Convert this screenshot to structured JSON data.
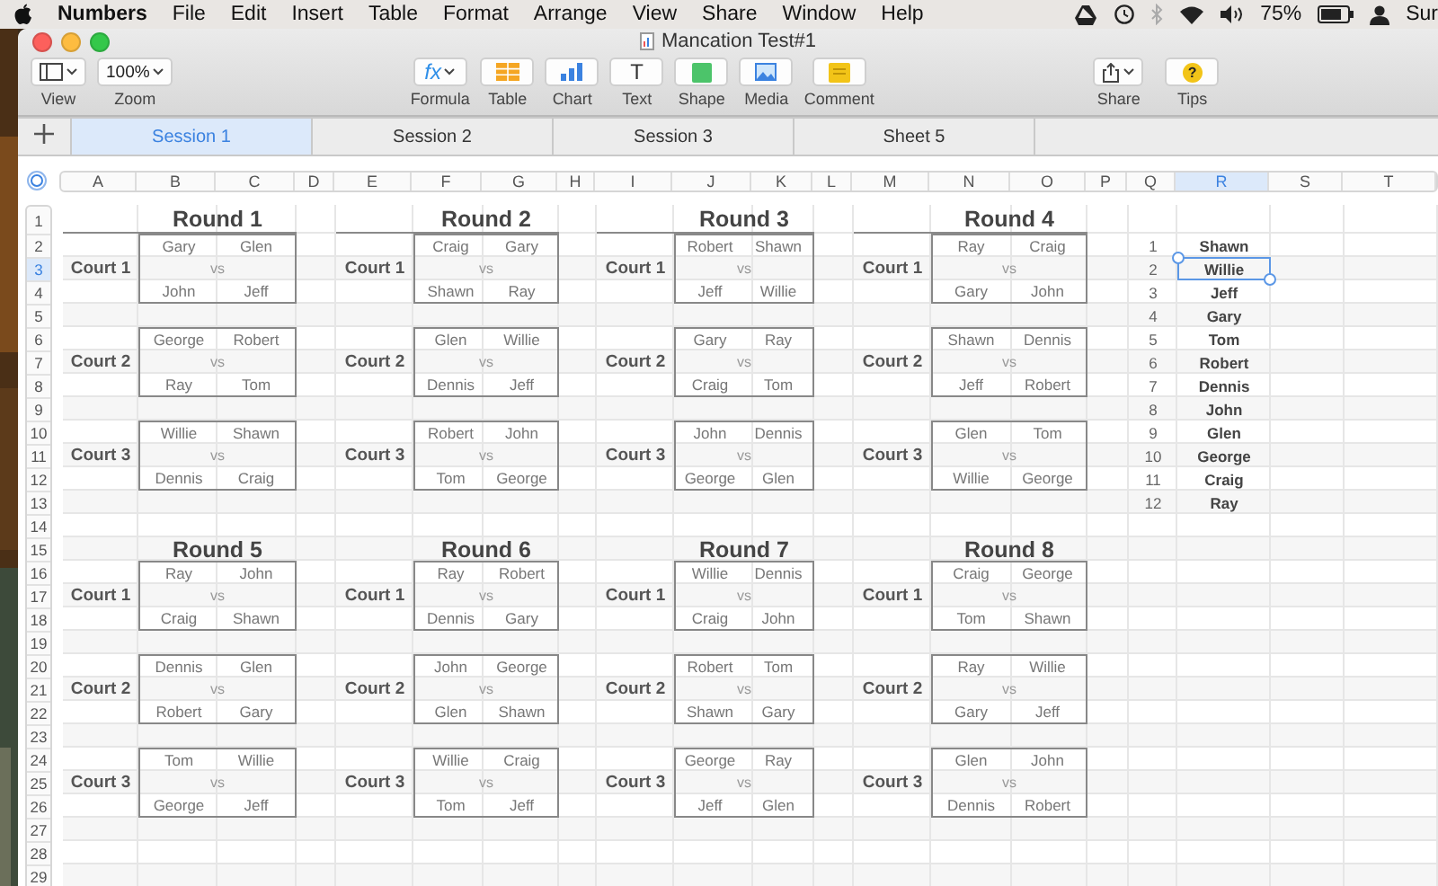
{
  "menu_bar": {
    "app": "Numbers",
    "items": [
      "File",
      "Edit",
      "Insert",
      "Table",
      "Format",
      "Arrange",
      "View",
      "Share",
      "Window",
      "Help"
    ],
    "battery": "75%",
    "user": "Sur"
  },
  "window": {
    "title": "Mancation Test#1"
  },
  "toolbar": {
    "left": [
      {
        "kind": "view",
        "label": "View"
      },
      {
        "kind": "zoom",
        "label": "Zoom",
        "value": "100%"
      }
    ],
    "center": [
      {
        "kind": "formula",
        "label": "Formula",
        "glyph": "fx"
      },
      {
        "kind": "table",
        "label": "Table"
      },
      {
        "kind": "chart",
        "label": "Chart"
      },
      {
        "kind": "text",
        "label": "Text",
        "glyph": "T"
      },
      {
        "kind": "shape",
        "label": "Shape"
      },
      {
        "kind": "media",
        "label": "Media"
      },
      {
        "kind": "comment",
        "label": "Comment"
      }
    ],
    "right": [
      {
        "kind": "share",
        "label": "Share"
      },
      {
        "kind": "tips",
        "label": "Tips",
        "glyph": "?"
      }
    ]
  },
  "sheets": [
    {
      "label": "Session 1",
      "selected": true
    },
    {
      "label": "Session 2",
      "selected": false
    },
    {
      "label": "Session 3",
      "selected": false
    },
    {
      "label": "Sheet 5",
      "selected": false
    }
  ],
  "columns": [
    {
      "label": "A",
      "selected": false
    },
    {
      "label": "B",
      "selected": false
    },
    {
      "label": "C",
      "selected": false
    },
    {
      "label": "D",
      "selected": false
    },
    {
      "label": "E",
      "selected": false
    },
    {
      "label": "F",
      "selected": false
    },
    {
      "label": "G",
      "selected": false
    },
    {
      "label": "H",
      "selected": false
    },
    {
      "label": "I",
      "selected": false
    },
    {
      "label": "J",
      "selected": false
    },
    {
      "label": "K",
      "selected": false
    },
    {
      "label": "L",
      "selected": false
    },
    {
      "label": "M",
      "selected": false
    },
    {
      "label": "N",
      "selected": false
    },
    {
      "label": "O",
      "selected": false
    },
    {
      "label": "P",
      "selected": false
    },
    {
      "label": "Q",
      "selected": false
    },
    {
      "label": "R",
      "selected": true
    },
    {
      "label": "S",
      "selected": false
    },
    {
      "label": "T",
      "selected": false
    }
  ],
  "rows": [
    {
      "label": "1",
      "selected": false
    },
    {
      "label": "2",
      "selected": false
    },
    {
      "label": "3",
      "selected": true
    },
    {
      "label": "4",
      "selected": false
    },
    {
      "label": "5",
      "selected": false
    },
    {
      "label": "6",
      "selected": false
    },
    {
      "label": "7",
      "selected": false
    },
    {
      "label": "8",
      "selected": false
    },
    {
      "label": "9",
      "selected": false
    },
    {
      "label": "10",
      "selected": false
    },
    {
      "label": "11",
      "selected": false
    },
    {
      "label": "12",
      "selected": false
    },
    {
      "label": "13",
      "selected": false
    },
    {
      "label": "14",
      "selected": false
    },
    {
      "label": "15",
      "selected": false
    },
    {
      "label": "16",
      "selected": false
    },
    {
      "label": "17",
      "selected": false
    },
    {
      "label": "18",
      "selected": false
    },
    {
      "label": "19",
      "selected": false
    },
    {
      "label": "20",
      "selected": false
    },
    {
      "label": "21",
      "selected": false
    },
    {
      "label": "22",
      "selected": false
    },
    {
      "label": "23",
      "selected": false
    },
    {
      "label": "24",
      "selected": false
    },
    {
      "label": "25",
      "selected": false
    },
    {
      "label": "26",
      "selected": false
    },
    {
      "label": "27",
      "selected": false
    },
    {
      "label": "28",
      "selected": false
    },
    {
      "label": "29",
      "selected": false
    }
  ],
  "rounds": [
    {
      "title": "Round 1",
      "courts": [
        {
          "label": "Court 1",
          "team_1": [
            "Gary",
            "Glen"
          ],
          "vs": "vs",
          "team_2": [
            "John",
            "Jeff"
          ]
        },
        {
          "label": "Court 2",
          "team_1": [
            "George",
            "Robert"
          ],
          "vs": "vs",
          "team_2": [
            "Ray",
            "Tom"
          ]
        },
        {
          "label": "Court 3",
          "team_1": [
            "Willie",
            "Shawn"
          ],
          "vs": "vs",
          "team_2": [
            "Dennis",
            "Craig"
          ]
        }
      ]
    },
    {
      "title": "Round 2",
      "courts": [
        {
          "label": "Court 1",
          "team_1": [
            "Craig",
            "Gary"
          ],
          "vs": "vs",
          "team_2": [
            "Shawn",
            "Ray"
          ]
        },
        {
          "label": "Court 2",
          "team_1": [
            "Glen",
            "Willie"
          ],
          "vs": "vs",
          "team_2": [
            "Dennis",
            "Jeff"
          ]
        },
        {
          "label": "Court 3",
          "team_1": [
            "Robert",
            "John"
          ],
          "vs": "vs",
          "team_2": [
            "Tom",
            "George"
          ]
        }
      ]
    },
    {
      "title": "Round 3",
      "courts": [
        {
          "label": "Court 1",
          "team_1": [
            "Robert",
            "Shawn"
          ],
          "vs": "vs",
          "team_2": [
            "Jeff",
            "Willie"
          ]
        },
        {
          "label": "Court 2",
          "team_1": [
            "Gary",
            "Ray"
          ],
          "vs": "vs",
          "team_2": [
            "Craig",
            "Tom"
          ]
        },
        {
          "label": "Court 3",
          "team_1": [
            "John",
            "Dennis"
          ],
          "vs": "vs",
          "team_2": [
            "George",
            "Glen"
          ]
        }
      ]
    },
    {
      "title": "Round 4",
      "courts": [
        {
          "label": "Court 1",
          "team_1": [
            "Ray",
            "Craig"
          ],
          "vs": "vs",
          "team_2": [
            "Gary",
            "John"
          ]
        },
        {
          "label": "Court 2",
          "team_1": [
            "Shawn",
            "Dennis"
          ],
          "vs": "vs",
          "team_2": [
            "Jeff",
            "Robert"
          ]
        },
        {
          "label": "Court 3",
          "team_1": [
            "Glen",
            "Tom"
          ],
          "vs": "vs",
          "team_2": [
            "Willie",
            "George"
          ]
        }
      ]
    },
    {
      "title": "Round 5",
      "courts": [
        {
          "label": "Court 1",
          "team_1": [
            "Ray",
            "John"
          ],
          "vs": "vs",
          "team_2": [
            "Craig",
            "Shawn"
          ]
        },
        {
          "label": "Court 2",
          "team_1": [
            "Dennis",
            "Glen"
          ],
          "vs": "vs",
          "team_2": [
            "Robert",
            "Gary"
          ]
        },
        {
          "label": "Court 3",
          "team_1": [
            "Tom",
            "Willie"
          ],
          "vs": "vs",
          "team_2": [
            "George",
            "Jeff"
          ]
        }
      ]
    },
    {
      "title": "Round 6",
      "courts": [
        {
          "label": "Court 1",
          "team_1": [
            "Ray",
            "Robert"
          ],
          "vs": "vs",
          "team_2": [
            "Dennis",
            "Gary"
          ]
        },
        {
          "label": "Court 2",
          "team_1": [
            "John",
            "George"
          ],
          "vs": "vs",
          "team_2": [
            "Glen",
            "Shawn"
          ]
        },
        {
          "label": "Court 3",
          "team_1": [
            "Willie",
            "Craig"
          ],
          "vs": "vs",
          "team_2": [
            "Tom",
            "Jeff"
          ]
        }
      ]
    },
    {
      "title": "Round 7",
      "courts": [
        {
          "label": "Court 1",
          "team_1": [
            "Willie",
            "Dennis"
          ],
          "vs": "vs",
          "team_2": [
            "Craig",
            "John"
          ]
        },
        {
          "label": "Court 2",
          "team_1": [
            "Robert",
            "Tom"
          ],
          "vs": "vs",
          "team_2": [
            "Shawn",
            "Gary"
          ]
        },
        {
          "label": "Court 3",
          "team_1": [
            "George",
            "Ray"
          ],
          "vs": "vs",
          "team_2": [
            "Jeff",
            "Glen"
          ]
        }
      ]
    },
    {
      "title": "Round 8",
      "courts": [
        {
          "label": "Court 1",
          "team_1": [
            "Craig",
            "George"
          ],
          "vs": "vs",
          "team_2": [
            "Tom",
            "Shawn"
          ]
        },
        {
          "label": "Court 2",
          "team_1": [
            "Ray",
            "Willie"
          ],
          "vs": "vs",
          "team_2": [
            "Gary",
            "Jeff"
          ]
        },
        {
          "label": "Court 3",
          "team_1": [
            "Glen",
            "John"
          ],
          "vs": "vs",
          "team_2": [
            "Dennis",
            "Robert"
          ]
        }
      ]
    }
  ],
  "roster": [
    {
      "number": "1",
      "name": "Shawn",
      "selected": false
    },
    {
      "number": "2",
      "name": "Willie",
      "selected": true
    },
    {
      "number": "3",
      "name": "Jeff",
      "selected": false
    },
    {
      "number": "4",
      "name": "Gary",
      "selected": false
    },
    {
      "number": "5",
      "name": "Tom",
      "selected": false
    },
    {
      "number": "6",
      "name": "Robert",
      "selected": false
    },
    {
      "number": "7",
      "name": "Dennis",
      "selected": false
    },
    {
      "number": "8",
      "name": "John",
      "selected": false
    },
    {
      "number": "9",
      "name": "Glen",
      "selected": false
    },
    {
      "number": "10",
      "name": "George",
      "selected": false
    },
    {
      "number": "11",
      "name": "Craig",
      "selected": false
    },
    {
      "number": "12",
      "name": "Ray",
      "selected": false
    }
  ]
}
